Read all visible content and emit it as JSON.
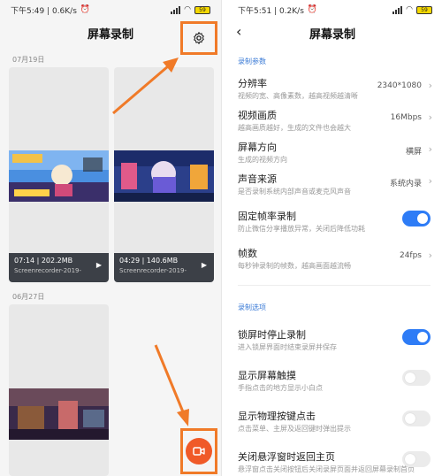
{
  "left": {
    "status": {
      "time": "下午5:49 | 0.6K/s",
      "battery": "59"
    },
    "title": "屏幕录制",
    "groups": [
      {
        "date": "07月19日"
      },
      {
        "date": "06月27日"
      }
    ],
    "recordings": [
      {
        "meta": "07:14 | 202.2MB",
        "name": "Screenrecorder-2019-"
      },
      {
        "meta": "04:29 | 140.6MB",
        "name": "Screenrecorder-2019-"
      }
    ]
  },
  "right": {
    "status": {
      "time": "下午5:51 | 0.2K/s",
      "battery": "59"
    },
    "title": "屏幕录制",
    "sections": {
      "params": "录制参数",
      "options": "录制选项"
    },
    "params": [
      {
        "title": "分辨率",
        "sub": "视频的宽、高像素数，越高视频越清晰",
        "value": "2340*1080"
      },
      {
        "title": "视频画质",
        "sub": "越高画质越好，生成的文件也会越大",
        "value": "16Mbps"
      },
      {
        "title": "屏幕方向",
        "sub": "生成的视频方向",
        "value": "横屏"
      },
      {
        "title": "声音来源",
        "sub": "是否录制系统内部声音或麦克风声音",
        "value": "系统内录"
      },
      {
        "title": "固定帧率录制",
        "sub": "防止微信分享播放异常，关闭后降低功耗",
        "toggle": "on"
      },
      {
        "title": "帧数",
        "sub": "每秒钟录制的帧数，越高画面越流畅",
        "value": "24fps"
      }
    ],
    "options": [
      {
        "title": "锁屏时停止录制",
        "sub": "进入锁屏界面时结束录屏并保存",
        "toggle": "on"
      },
      {
        "title": "显示屏幕触摸",
        "sub": "手指点击的地方显示小白点",
        "toggle": "off"
      },
      {
        "title": "显示物理按键点击",
        "sub": "点击菜单、主屏及返回键时弹出提示",
        "toggle": "off"
      },
      {
        "title": "关闭悬浮窗时返回主页",
        "sub": "悬浮窗点击关闭按钮后关闭录屏页面并返回屏幕录制首页",
        "toggle": "off"
      }
    ]
  },
  "colors": {
    "accent_orange": "#f07a28",
    "record_button": "#f05a28",
    "toggle_on": "#2e7cf6",
    "section_label": "#3b7bd6"
  }
}
